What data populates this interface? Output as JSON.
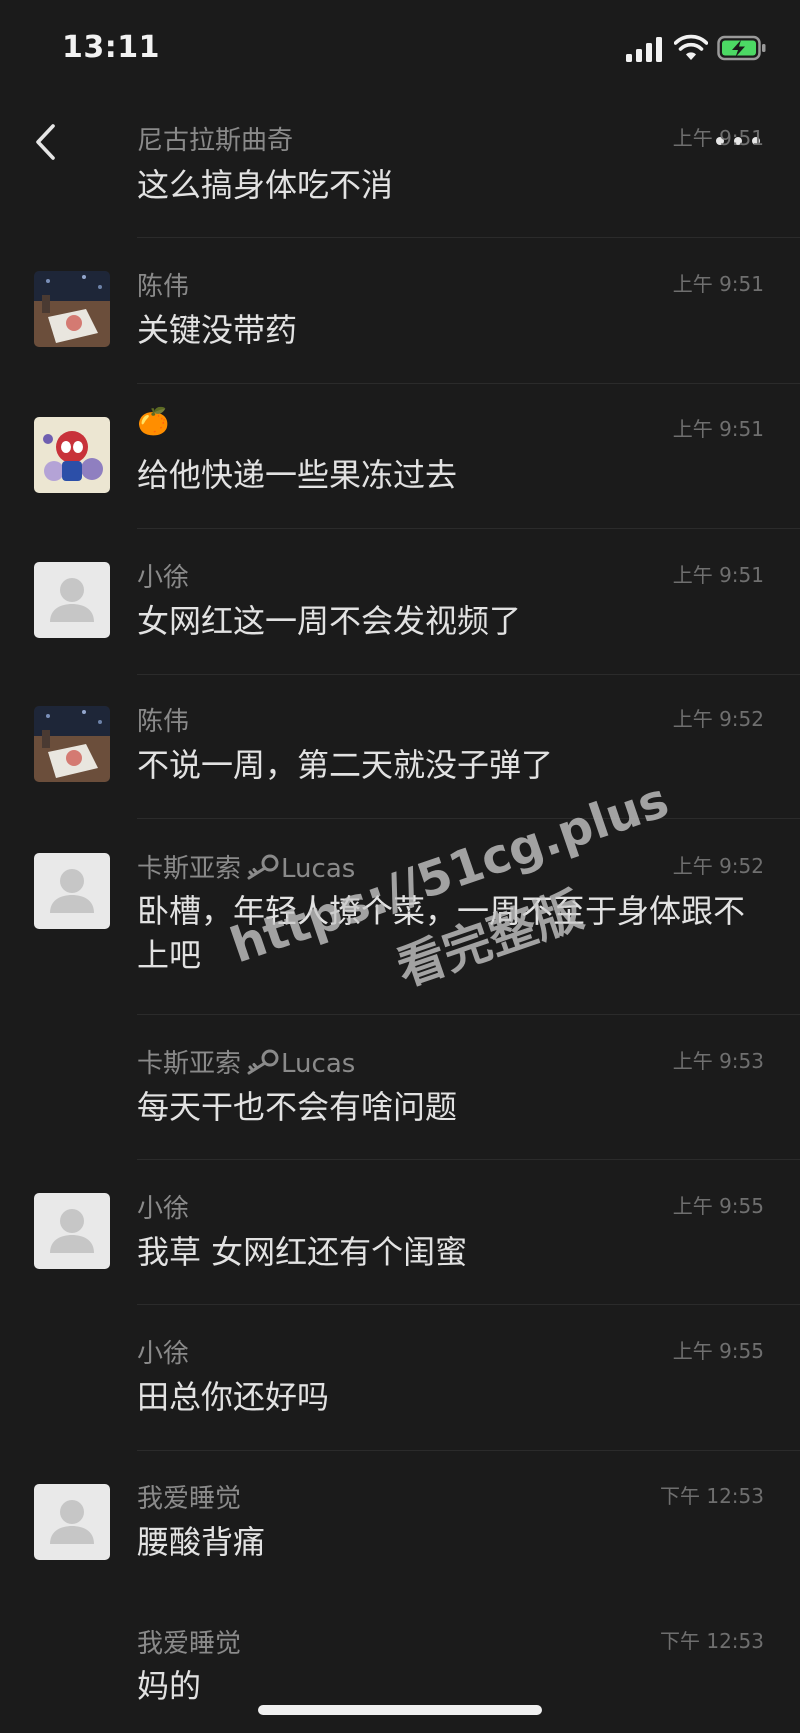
{
  "status_bar": {
    "time": "13:11",
    "signal_icon": "cellular-signal-icon",
    "wifi_icon": "wifi-icon",
    "battery_icon": "battery-charging-icon",
    "battery_color": "#4cd964"
  },
  "nav": {
    "back_icon": "chevron-left-icon",
    "more_icon": "more-dots-icon"
  },
  "messages": [
    {
      "sender": "尼古拉斯曲奇",
      "time": "上午 9:51",
      "text": "这么搞身体吃不消",
      "avatar": "none"
    },
    {
      "sender": "陈伟",
      "time": "上午 9:51",
      "text": "关键没带药",
      "avatar": "photo-table"
    },
    {
      "sender": "🍊",
      "time": "上午 9:51",
      "text": "给他快递一些果冻过去",
      "avatar": "spiderman-cartoon"
    },
    {
      "sender": "小徐",
      "time": "上午 9:51",
      "text": "女网红这一周不会发视频了",
      "avatar": "default"
    },
    {
      "sender": "陈伟",
      "time": "上午 9:52",
      "text": "不说一周，第二天就没子弹了",
      "avatar": "photo-table"
    },
    {
      "sender_prefix": "卡斯亚索",
      "sender_suffix": "Lucas",
      "time": "上午 9:52",
      "text": "卧槽，年轻人撩个菜，一周不至于身体跟不上吧",
      "avatar": "default"
    },
    {
      "sender_prefix": "卡斯亚索",
      "sender_suffix": "Lucas",
      "time": "上午 9:53",
      "text": "每天干也不会有啥问题",
      "avatar": "none"
    },
    {
      "sender": "小徐",
      "time": "上午 9:55",
      "text": "我草 女网红还有个闺蜜",
      "avatar": "default"
    },
    {
      "sender": "小徐",
      "time": "上午 9:55",
      "text": "田总你还好吗",
      "avatar": "none"
    },
    {
      "sender": "我爱睡觉",
      "time": "下午 12:53",
      "text": "腰酸背痛",
      "avatar": "default"
    },
    {
      "sender": "我爱睡觉",
      "time": "下午 12:53",
      "text": "妈的",
      "avatar": "none"
    }
  ],
  "watermark": {
    "line1": "https://51cg.plus",
    "line2": "看完整版"
  }
}
